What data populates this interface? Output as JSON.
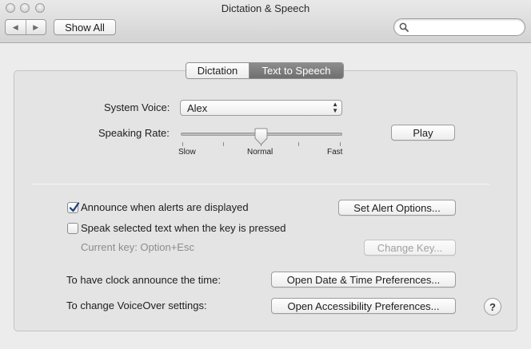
{
  "window": {
    "title": "Dictation & Speech"
  },
  "toolbar": {
    "back_glyph": "◀",
    "forward_glyph": "▶",
    "show_all_label": "Show All",
    "search_placeholder": "",
    "search_icon": "search-icon"
  },
  "tabs": [
    {
      "label": "Dictation",
      "selected": false
    },
    {
      "label": "Text to Speech",
      "selected": true
    }
  ],
  "voice": {
    "system_voice_label": "System Voice:",
    "system_voice_value": "Alex",
    "speaking_rate_label": "Speaking Rate:",
    "rate_ticks": [
      "Slow",
      "Normal",
      "Fast"
    ],
    "rate_value": "Normal",
    "play_label": "Play"
  },
  "alerts": {
    "announce_label": "Announce when alerts are displayed",
    "announce_checked": true,
    "set_alert_options_label": "Set Alert Options...",
    "speak_selected_label": "Speak selected text when the key is pressed",
    "speak_selected_checked": false,
    "current_key_label": "Current key: Option+Esc",
    "change_key_label": "Change Key..."
  },
  "other": {
    "clock_label": "To have clock announce the time:",
    "date_time_button": "Open Date & Time Preferences...",
    "voiceover_label": "To change VoiceOver settings:",
    "accessibility_button": "Open Accessibility Preferences...",
    "help_label": "?"
  }
}
